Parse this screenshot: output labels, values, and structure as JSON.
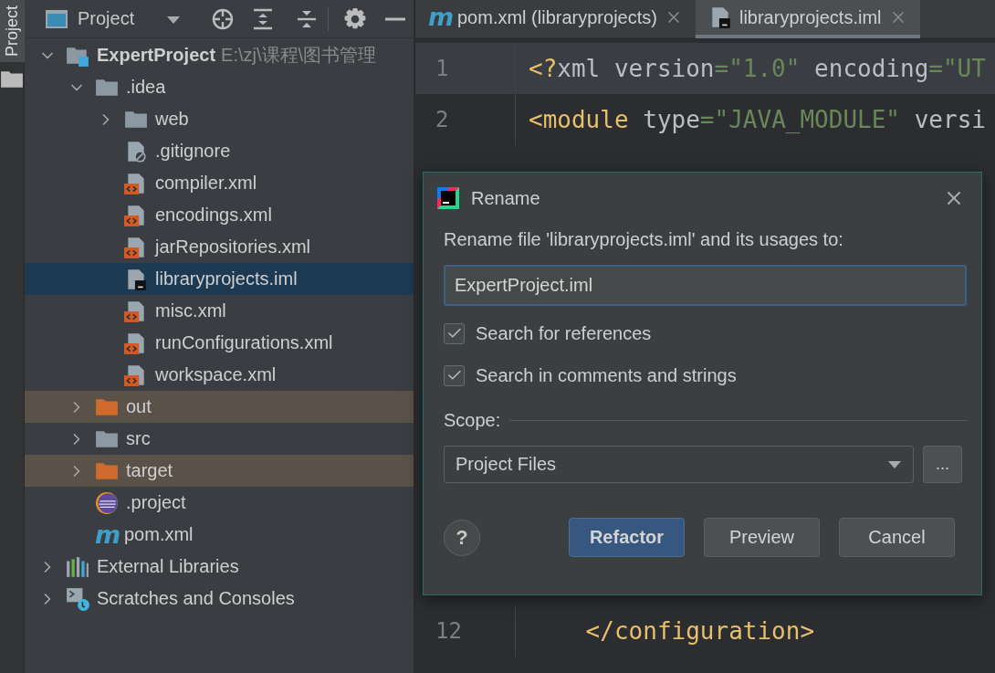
{
  "side_stripe": {
    "tab": "Project"
  },
  "project_panel": {
    "title": "Project",
    "tree": [
      {
        "label": "ExpertProject",
        "kind": "project",
        "hint": "E:\\zj\\课程\\图书管理",
        "expanded": true,
        "selected": false,
        "children": [
          {
            "label": ".idea",
            "kind": "folder",
            "expanded": true,
            "selected": false,
            "children": [
              {
                "label": "web",
                "kind": "folder",
                "expanded": false,
                "selected": false
              },
              {
                "label": ".gitignore",
                "kind": "gitignore",
                "selected": false
              },
              {
                "label": "compiler.xml",
                "kind": "xml",
                "selected": false
              },
              {
                "label": "encodings.xml",
                "kind": "xml",
                "selected": false
              },
              {
                "label": "jarRepositories.xml",
                "kind": "xml",
                "selected": false
              },
              {
                "label": "libraryprojects.iml",
                "kind": "iml",
                "selected": true
              },
              {
                "label": "misc.xml",
                "kind": "xml",
                "selected": false
              },
              {
                "label": "runConfigurations.xml",
                "kind": "xml",
                "selected": false
              },
              {
                "label": "workspace.xml",
                "kind": "xml",
                "selected": false
              }
            ]
          },
          {
            "label": "out",
            "kind": "excluded",
            "expanded": false,
            "selected": false
          },
          {
            "label": "src",
            "kind": "folder",
            "expanded": false,
            "selected": false
          },
          {
            "label": "target",
            "kind": "excluded",
            "expanded": false,
            "selected": false
          },
          {
            "label": ".project",
            "kind": "eclipse",
            "selected": false
          },
          {
            "label": "pom.xml",
            "kind": "maven",
            "icon_text": "m",
            "selected": false
          }
        ]
      },
      {
        "label": "External Libraries",
        "kind": "libraries",
        "expanded": false,
        "selected": false
      },
      {
        "label": "Scratches and Consoles",
        "kind": "scratches",
        "expanded": false,
        "selected": false
      }
    ]
  },
  "editor": {
    "tabs": [
      {
        "label": "pom.xml (libraryprojects)",
        "kind": "maven",
        "icon_text": "m",
        "selected": false
      },
      {
        "label": "libraryprojects.iml",
        "kind": "iml",
        "selected": true
      }
    ],
    "lines": [
      {
        "number": "1",
        "current": true,
        "tokens": [
          {
            "kind": "tag",
            "text": "<?"
          },
          {
            "kind": "text",
            "text": "xml version"
          },
          {
            "kind": "value",
            "text": "=\"1.0\""
          },
          {
            "kind": "text",
            "text": " encoding"
          },
          {
            "kind": "value",
            "text": "=\"UT"
          }
        ]
      },
      {
        "number": "2",
        "current": false,
        "tokens": [
          {
            "kind": "tag",
            "text": "<module"
          },
          {
            "kind": "text",
            "text": " type"
          },
          {
            "kind": "value",
            "text": "=\"JAVA_MODULE\""
          },
          {
            "kind": "text",
            "text": " versi"
          }
        ]
      },
      {
        "number": "12",
        "current": false,
        "tokens": [
          {
            "kind": "tag",
            "text": "    </configuration>"
          }
        ]
      }
    ]
  },
  "rename_dialog": {
    "title": "Rename",
    "prompt": "Rename file 'libraryprojects.iml' and its usages to:",
    "value": "ExpertProject.iml",
    "options": [
      {
        "label": "Search for references",
        "checked": true
      },
      {
        "label": "Search in comments and strings",
        "checked": true
      }
    ],
    "scope_label": "Scope:",
    "scope": "Project Files",
    "browse": "...",
    "help": "?",
    "buttons": [
      {
        "label": "Refactor",
        "default": true
      },
      {
        "label": "Preview",
        "default": false
      },
      {
        "label": "Cancel",
        "default": false
      }
    ]
  }
}
